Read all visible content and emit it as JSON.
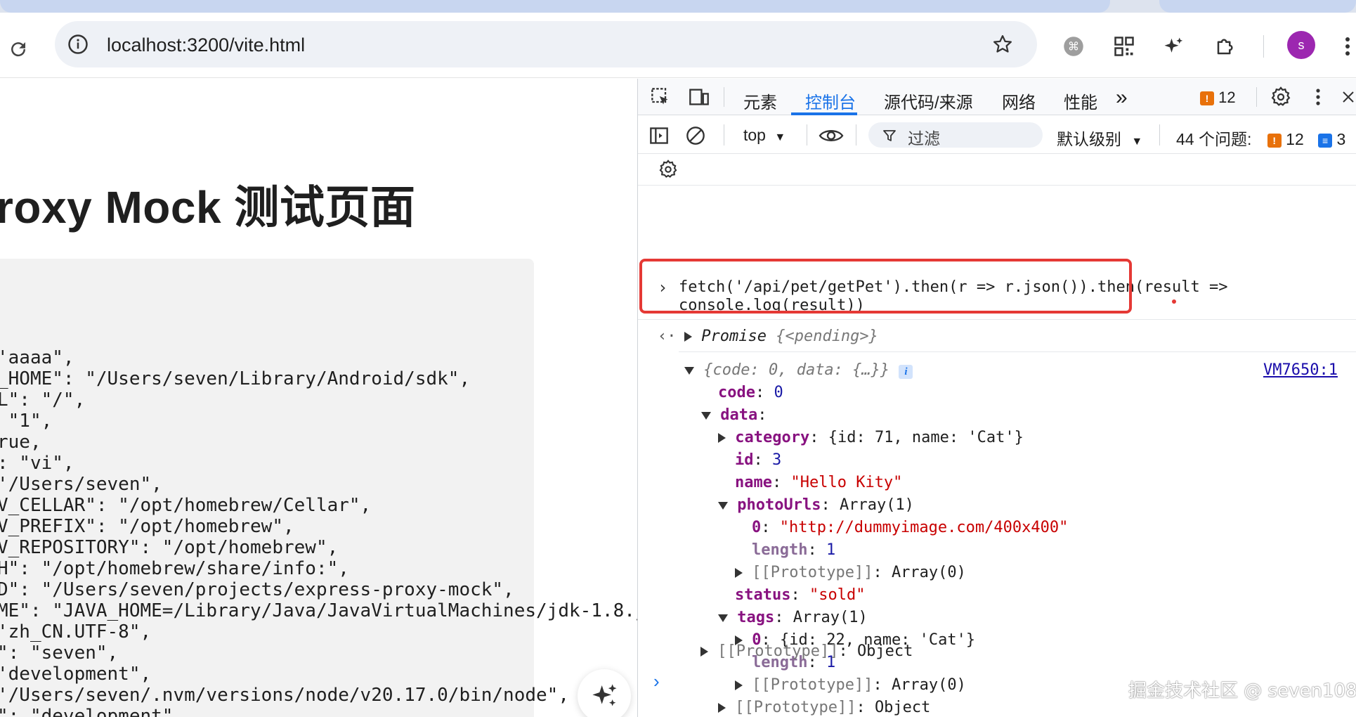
{
  "browser": {
    "url": "localhost:3200/vite.html",
    "avatar_letter": "s",
    "accent": "#1a73e8",
    "avatar_color": "#9c27b0"
  },
  "page": {
    "title": "roxy Mock 测试页面",
    "pre_lines": [
      "'aaaa\",",
      "_HOME\": \"/Users/seven/Library/Android/sdk\",",
      "L\": \"/\",",
      " \"1\",",
      "rue,",
      ": \"vi\",",
      "'/Users/seven\",",
      "V_CELLAR\": \"/opt/homebrew/Cellar\",",
      "V_PREFIX\": \"/opt/homebrew\",",
      "V_REPOSITORY\": \"/opt/homebrew\",",
      "H\": \"/opt/homebrew/share/info:\",",
      "D\": \"/Users/seven/projects/express-proxy-mock\",",
      "ME\": \"JAVA_HOME=/Library/Java/JavaVirtualMachines/jdk-1.8.j",
      "'zh_CN.UTF-8\",",
      "\": \"seven\",",
      "'development\",",
      "'/Users/seven/.nvm/versions/node/v20.17.0/bin/node\",",
      "\": \"development\""
    ]
  },
  "devtools": {
    "tabs": [
      "元素",
      "控制台",
      "源代码/来源",
      "网络",
      "性能"
    ],
    "more_tabs": "»",
    "issue_count": "12",
    "context": "top",
    "filter_placeholder": "过滤",
    "level": "默认级别",
    "issues_label": "44 个问题:",
    "issues_warn": "12",
    "issues_info": "3",
    "console": {
      "input_line1": "fetch('/api/pet/getPet').then(r => r.json()).then(result =>",
      "input_line2": "console.log(result))",
      "promise_label": "Promise",
      "promise_state": "{<pending>}",
      "source_link": "VM7650:1",
      "obj_summary": "{code: 0, data: {…}}",
      "code_key": "code",
      "code_val": "0",
      "data_key": "data",
      "category_key": "category",
      "category_val": "{id: 71, name: 'Cat'}",
      "id_key": "id",
      "id_val": "3",
      "name_key": "name",
      "name_val": "\"Hello Kity\"",
      "photo_key": "photoUrls",
      "photo_val": "Array(1)",
      "photo_item_key": "0",
      "photo_item_val": "\"http://dummyimage.com/400x400\"",
      "length_key": "length",
      "length_val": "1",
      "proto_key": "[[Prototype]]",
      "proto_array": "Array(0)",
      "status_key": "status",
      "status_val": "\"sold\"",
      "tags_key": "tags",
      "tags_val": "Array(1)",
      "tag0_key": "0",
      "tag0_val": "{id: 22, name: 'Cat'}",
      "proto_object": "Object"
    }
  },
  "watermark": "掘金技术社区 @ seven108"
}
